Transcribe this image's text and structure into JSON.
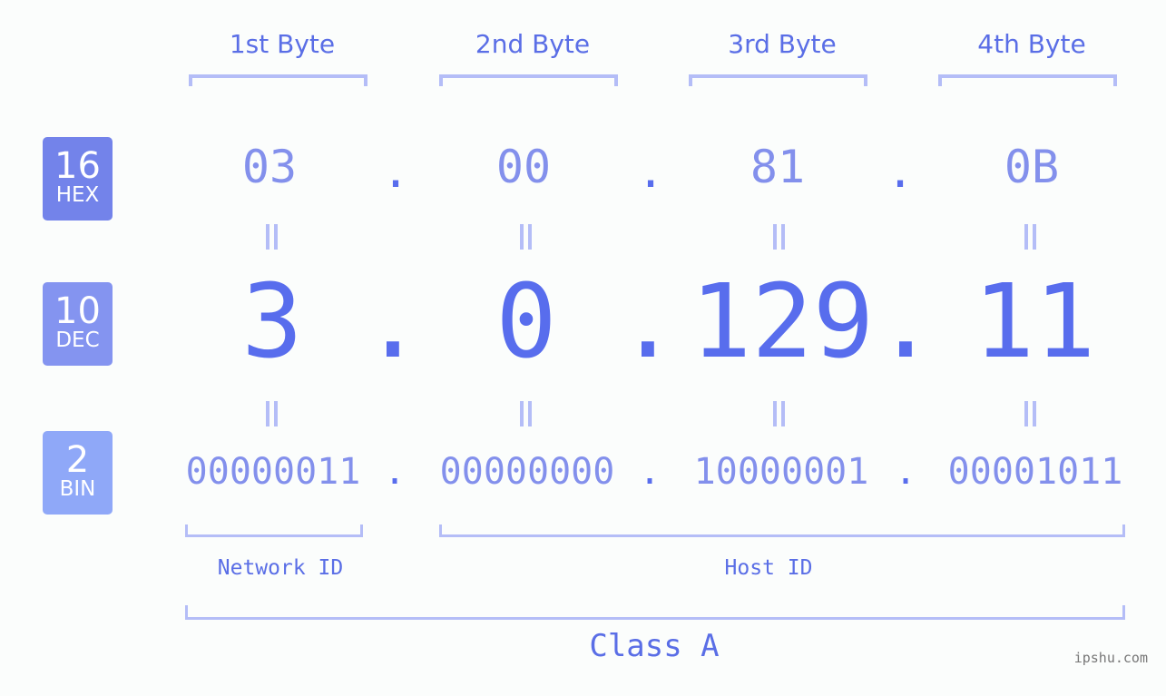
{
  "bytes": [
    {
      "label": "1st Byte",
      "hex": "03",
      "dec": "3",
      "bin": "00000011"
    },
    {
      "label": "2nd Byte",
      "hex": "00",
      "dec": "0",
      "bin": "00000000"
    },
    {
      "label": "3rd Byte",
      "hex": "81",
      "dec": "129",
      "bin": "10000001"
    },
    {
      "label": "4th Byte",
      "hex": "0B",
      "dec": "11",
      "bin": "00001011"
    }
  ],
  "separator": ".",
  "bases": {
    "hex": {
      "num": "16",
      "label": "HEX",
      "color": "#7383ea"
    },
    "dec": {
      "num": "10",
      "label": "DEC",
      "color": "#8494f0"
    },
    "bin": {
      "num": "2",
      "label": "BIN",
      "color": "#8fa8f8"
    }
  },
  "segments": {
    "network": "Network ID",
    "host": "Host ID"
  },
  "ip_class": "Class A",
  "watermark": "ipshu.com"
}
